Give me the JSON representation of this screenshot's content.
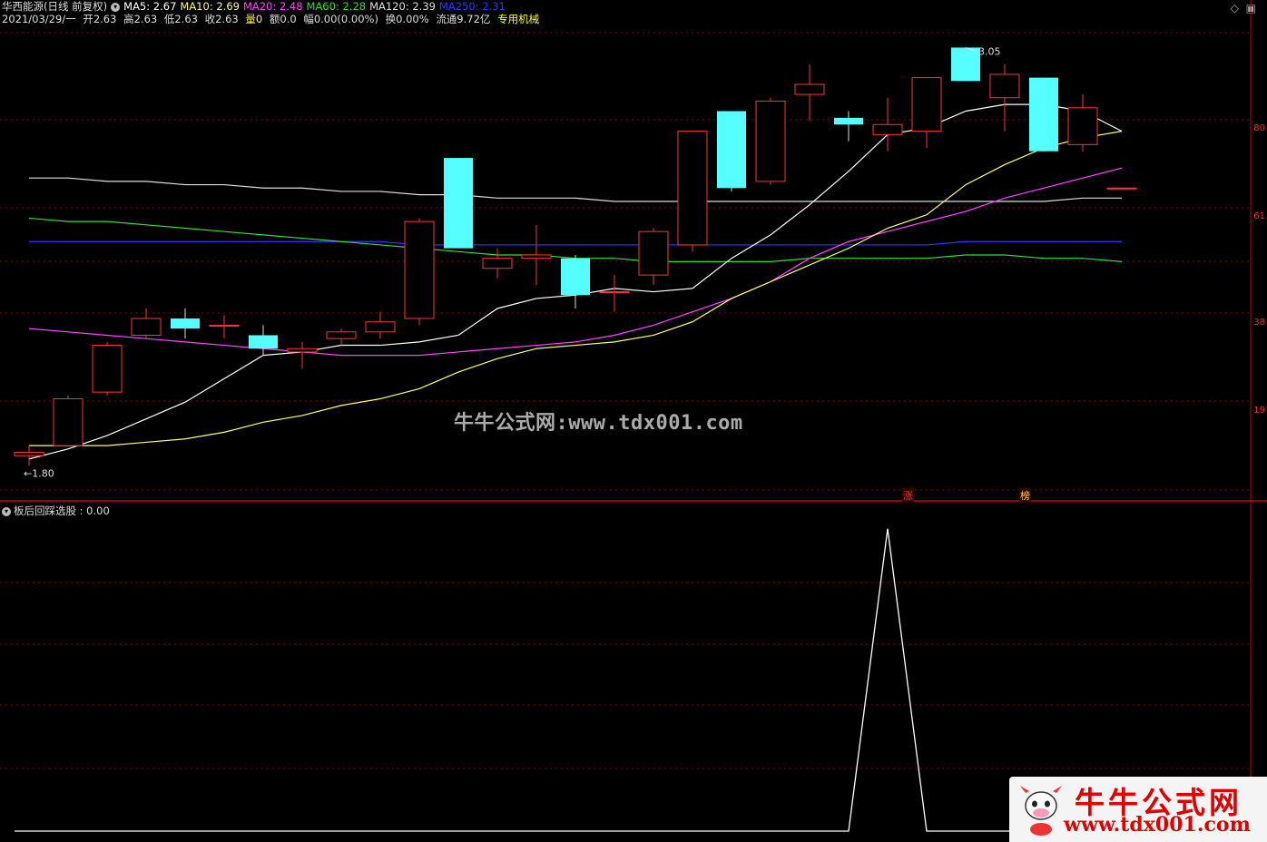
{
  "header": {
    "stock_name": "华西能源(日线 前复权)",
    "ma": [
      {
        "label": "MA5: 2.67",
        "color": "#ffffff"
      },
      {
        "label": "MA10: 2.69",
        "color": "#ffff66"
      },
      {
        "label": "MA20: 2.48",
        "color": "#ff44ff"
      },
      {
        "label": "MA60: 2.28",
        "color": "#33dd33"
      },
      {
        "label": "MA120: 2.39",
        "color": "#dddddd"
      },
      {
        "label": "MA250: 2.31",
        "color": "#3333ff"
      }
    ],
    "date": "2021/03/29/一",
    "open": "开2.63",
    "high": "高2.63",
    "low": "低2.63",
    "close": "收2.63",
    "volume": "量0",
    "amount": "额0.0",
    "change": "幅0.00(0.00%)",
    "turnover": "换0.00%",
    "float_cap": "流通9.72亿",
    "sector": "专用机械"
  },
  "watermark": "牛牛公式网:www.tdx001.com",
  "indicator_header": "板后回踩选股 : 0.00",
  "right_axis_ticks": [
    "80",
    "61",
    "38",
    "19"
  ],
  "markers": {
    "zhang": "涨",
    "bang": "榜"
  },
  "logo": {
    "cn": "牛牛公式网",
    "url": "www.tdx001.com"
  },
  "colors": {
    "up": "#ff3333",
    "down": "#55ffff",
    "grid": "#8b0000",
    "ma5": "#ffffff",
    "ma10": "#ffff66",
    "ma20": "#ff44ff",
    "ma60": "#33dd33",
    "ma120": "#dddddd",
    "ma250": "#3333ff"
  },
  "chart_data": [
    {
      "type": "candlestick",
      "title": "华西能源(日线 前复权)",
      "annotations": [
        {
          "label": "3.05",
          "kind": "high"
        },
        {
          "label": "1.80",
          "kind": "low"
        }
      ],
      "candles": [
        {
          "o": 1.83,
          "h": 1.86,
          "l": 1.8,
          "c": 1.84
        },
        {
          "o": 1.86,
          "h": 2.01,
          "l": 1.86,
          "c": 2.0
        },
        {
          "o": 2.02,
          "h": 2.17,
          "l": 2.01,
          "c": 2.16
        },
        {
          "o": 2.19,
          "h": 2.27,
          "l": 2.18,
          "c": 2.24
        },
        {
          "o": 2.24,
          "h": 2.27,
          "l": 2.18,
          "c": 2.21
        },
        {
          "o": 2.22,
          "h": 2.25,
          "l": 2.18,
          "c": 2.22
        },
        {
          "o": 2.19,
          "h": 2.22,
          "l": 2.13,
          "c": 2.15
        },
        {
          "o": 2.14,
          "h": 2.17,
          "l": 2.09,
          "c": 2.15
        },
        {
          "o": 2.18,
          "h": 2.21,
          "l": 2.16,
          "c": 2.2
        },
        {
          "o": 2.2,
          "h": 2.26,
          "l": 2.18,
          "c": 2.23
        },
        {
          "o": 2.24,
          "h": 2.54,
          "l": 2.22,
          "c": 2.53
        },
        {
          "o": 2.72,
          "h": 2.72,
          "l": 2.45,
          "c": 2.45
        },
        {
          "o": 2.39,
          "h": 2.45,
          "l": 2.36,
          "c": 2.42
        },
        {
          "o": 2.42,
          "h": 2.52,
          "l": 2.34,
          "c": 2.43
        },
        {
          "o": 2.42,
          "h": 2.43,
          "l": 2.27,
          "c": 2.31
        },
        {
          "o": 2.32,
          "h": 2.37,
          "l": 2.26,
          "c": 2.32
        },
        {
          "o": 2.37,
          "h": 2.51,
          "l": 2.34,
          "c": 2.5
        },
        {
          "o": 2.46,
          "h": 2.8,
          "l": 2.44,
          "c": 2.8
        },
        {
          "o": 2.86,
          "h": 2.86,
          "l": 2.62,
          "c": 2.63
        },
        {
          "o": 2.65,
          "h": 2.9,
          "l": 2.64,
          "c": 2.89
        },
        {
          "o": 2.91,
          "h": 3.0,
          "l": 2.83,
          "c": 2.94
        },
        {
          "o": 2.84,
          "h": 2.86,
          "l": 2.77,
          "c": 2.82
        },
        {
          "o": 2.79,
          "h": 2.9,
          "l": 2.74,
          "c": 2.82
        },
        {
          "o": 2.8,
          "h": 2.92,
          "l": 2.75,
          "c": 2.96
        },
        {
          "o": 3.05,
          "h": 3.05,
          "l": 2.95,
          "c": 2.95
        },
        {
          "o": 2.9,
          "h": 3.0,
          "l": 2.8,
          "c": 2.97
        },
        {
          "o": 2.96,
          "h": 2.96,
          "l": 2.74,
          "c": 2.74
        },
        {
          "o": 2.76,
          "h": 2.91,
          "l": 2.74,
          "c": 2.87
        },
        {
          "o": 2.63,
          "h": 2.63,
          "l": 2.63,
          "c": 2.63
        }
      ],
      "ma5": [
        1.82,
        1.85,
        1.89,
        1.94,
        1.99,
        2.06,
        2.13,
        2.14,
        2.16,
        2.16,
        2.17,
        2.19,
        2.27,
        2.3,
        2.31,
        2.33,
        2.32,
        2.33,
        2.42,
        2.49,
        2.58,
        2.68,
        2.79,
        2.81,
        2.86,
        2.88,
        2.88,
        2.86,
        2.8
      ],
      "ma10": [
        1.86,
        1.86,
        1.86,
        1.87,
        1.88,
        1.9,
        1.93,
        1.95,
        1.98,
        2.0,
        2.03,
        2.08,
        2.12,
        2.15,
        2.16,
        2.17,
        2.19,
        2.23,
        2.3,
        2.35,
        2.4,
        2.45,
        2.51,
        2.55,
        2.64,
        2.7,
        2.75,
        2.78,
        2.8
      ],
      "ma20": [
        2.21,
        2.2,
        2.19,
        2.18,
        2.17,
        2.16,
        2.15,
        2.14,
        2.13,
        2.13,
        2.13,
        2.14,
        2.15,
        2.16,
        2.17,
        2.19,
        2.22,
        2.26,
        2.3,
        2.35,
        2.42,
        2.47,
        2.5,
        2.53,
        2.56,
        2.6,
        2.63,
        2.66,
        2.69
      ],
      "ma60": [
        2.54,
        2.53,
        2.53,
        2.52,
        2.51,
        2.5,
        2.49,
        2.48,
        2.47,
        2.46,
        2.45,
        2.44,
        2.43,
        2.43,
        2.42,
        2.42,
        2.41,
        2.41,
        2.41,
        2.41,
        2.42,
        2.42,
        2.42,
        2.42,
        2.43,
        2.43,
        2.42,
        2.42,
        2.41
      ],
      "ma120": [
        2.66,
        2.66,
        2.65,
        2.65,
        2.64,
        2.64,
        2.63,
        2.63,
        2.62,
        2.62,
        2.61,
        2.61,
        2.6,
        2.6,
        2.6,
        2.59,
        2.59,
        2.59,
        2.59,
        2.59,
        2.59,
        2.59,
        2.59,
        2.59,
        2.59,
        2.59,
        2.59,
        2.6,
        2.6
      ],
      "ma250": [
        2.47,
        2.47,
        2.47,
        2.47,
        2.47,
        2.47,
        2.47,
        2.47,
        2.47,
        2.47,
        2.46,
        2.46,
        2.46,
        2.46,
        2.46,
        2.46,
        2.46,
        2.46,
        2.46,
        2.46,
        2.46,
        2.46,
        2.46,
        2.46,
        2.47,
        2.47,
        2.47,
        2.47,
        2.47
      ],
      "ylim": [
        1.76,
        3.1
      ]
    },
    {
      "type": "line",
      "title": "板后回踩选股",
      "x_index": [
        0,
        1,
        2,
        3,
        4,
        5,
        6,
        7,
        8,
        9,
        10,
        11,
        12,
        13,
        14,
        15,
        16,
        17,
        18,
        19,
        20,
        21,
        22,
        23,
        24,
        25,
        26,
        27,
        28
      ],
      "values": [
        0,
        0,
        0,
        0,
        0,
        0,
        0,
        0,
        0,
        0,
        0,
        0,
        0,
        0,
        0,
        0,
        0,
        0,
        0,
        0,
        0,
        0,
        1,
        0,
        0,
        0,
        0,
        0,
        0
      ],
      "ylim": [
        0,
        1.05
      ]
    }
  ]
}
